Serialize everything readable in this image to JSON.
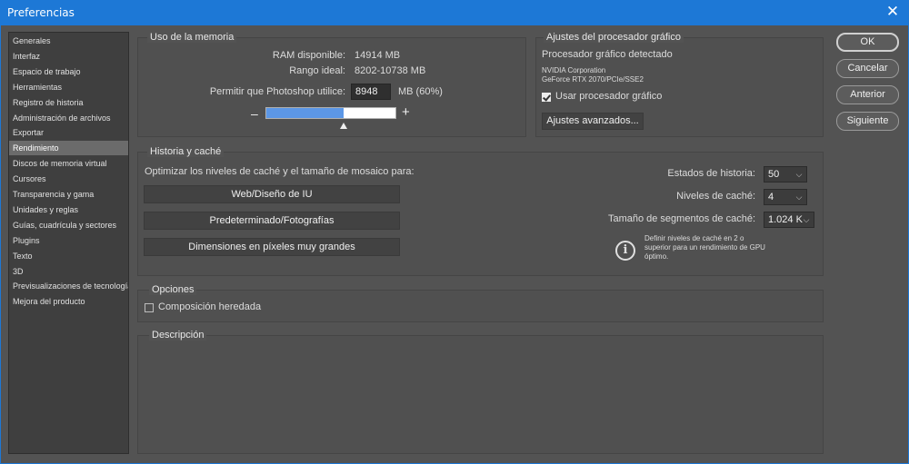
{
  "window": {
    "title": "Preferencias",
    "close_glyph": "✕"
  },
  "sidebar": {
    "items": [
      {
        "label": "Generales",
        "selected": false
      },
      {
        "label": "Interfaz",
        "selected": false
      },
      {
        "label": "Espacio de trabajo",
        "selected": false
      },
      {
        "label": "Herramientas",
        "selected": false
      },
      {
        "label": "Registro de historia",
        "selected": false
      },
      {
        "label": "Administración de archivos",
        "selected": false
      },
      {
        "label": "Exportar",
        "selected": false
      },
      {
        "label": "Rendimiento",
        "selected": true
      },
      {
        "label": "Discos de memoria virtual",
        "selected": false
      },
      {
        "label": "Cursores",
        "selected": false
      },
      {
        "label": "Transparencia y gama",
        "selected": false
      },
      {
        "label": "Unidades y reglas",
        "selected": false
      },
      {
        "label": "Guías, cuadrícula y sectores",
        "selected": false
      },
      {
        "label": "Plugins",
        "selected": false
      },
      {
        "label": "Texto",
        "selected": false
      },
      {
        "label": "3D",
        "selected": false
      },
      {
        "label": "Previsualizaciones de tecnología",
        "selected": false
      },
      {
        "label": "Mejora del producto",
        "selected": false
      }
    ]
  },
  "memory": {
    "title": "Uso de la memoria",
    "ram_label": "RAM disponible:",
    "ram_value": "14914 MB",
    "ideal_label": "Rango ideal:",
    "ideal_value": "8202-10738 MB",
    "allow_label": "Permitir que Photoshop utilice:",
    "allow_value": "8948",
    "allow_unit": "MB (60%)",
    "minus": "–",
    "plus": "+",
    "slider_fraction": 0.6
  },
  "gpu": {
    "title": "Ajustes del procesador gráfico",
    "detected_label": "Procesador gráfico detectado",
    "vendor": "NVIDIA Corporation",
    "model": "GeForce RTX 2070/PCIe/SSE2",
    "use_gpu_label": "Usar procesador gráfico",
    "use_gpu_checked": true,
    "advanced_button": "Ajustes avanzados..."
  },
  "history_cache": {
    "title": "Historia y caché",
    "optimize_label": "Optimizar los niveles de caché y el tamaño de mosaico para:",
    "buttons": [
      "Web/Diseño de IU",
      "Predeterminado/Fotografías",
      "Dimensiones en píxeles muy grandes"
    ],
    "history_states_label": "Estados de historia:",
    "history_states_value": "50",
    "cache_levels_label": "Niveles de caché:",
    "cache_levels_value": "4",
    "tile_size_label": "Tamaño de segmentos de caché:",
    "tile_size_value": "1.024 K",
    "info_text": "Definir niveles de caché en 2 o superior para un rendimiento de GPU óptimo.",
    "info_line1": "Definir niveles de caché en 2 o",
    "info_line2": "superior para un rendimiento de GPU",
    "info_line3": "óptimo."
  },
  "options": {
    "title": "Opciones",
    "legacy_label": "Composición heredada",
    "legacy_checked": false
  },
  "description": {
    "title": "Descripción"
  },
  "actions": {
    "ok": "OK",
    "cancel": "Cancelar",
    "prev": "Anterior",
    "next": "Siguiente"
  },
  "colors": {
    "titlebar": "#1d78d6",
    "slider_fill": "#5c97e6"
  }
}
